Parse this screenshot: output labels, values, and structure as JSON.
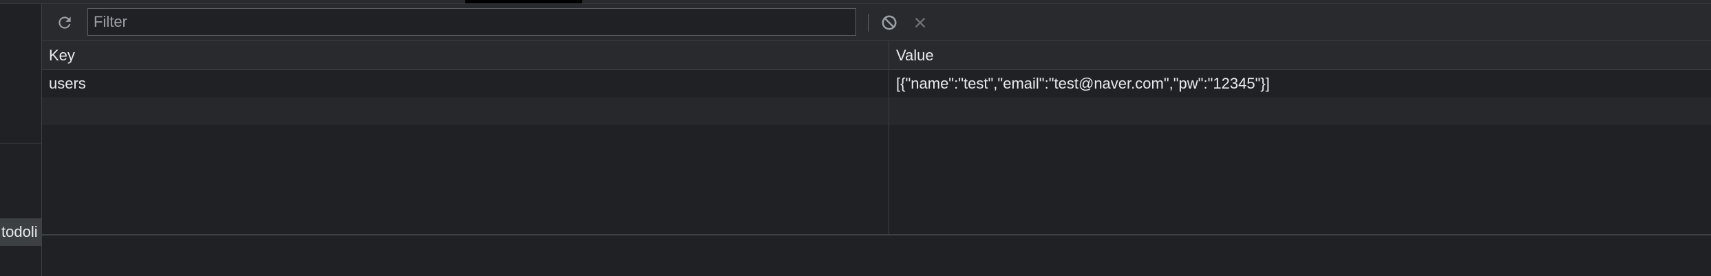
{
  "sidebar": {
    "selected_item_label": "todoli"
  },
  "toolbar": {
    "refresh_icon": "refresh-icon",
    "filter_placeholder": "Filter",
    "filter_value": "",
    "clear_all_icon": "block-icon",
    "delete_icon": "close-icon"
  },
  "table": {
    "columns": [
      "Key",
      "Value"
    ],
    "rows": [
      {
        "key": "users",
        "value": "[{\"name\":\"test\",\"email\":\"test@naver.com\",\"pw\":\"12345\"}]"
      },
      {
        "key": "",
        "value": ""
      }
    ]
  },
  "colors": {
    "background": "#202124",
    "toolbar": "#292a2d",
    "border": "#3c4043",
    "text": "#e8eaed"
  }
}
